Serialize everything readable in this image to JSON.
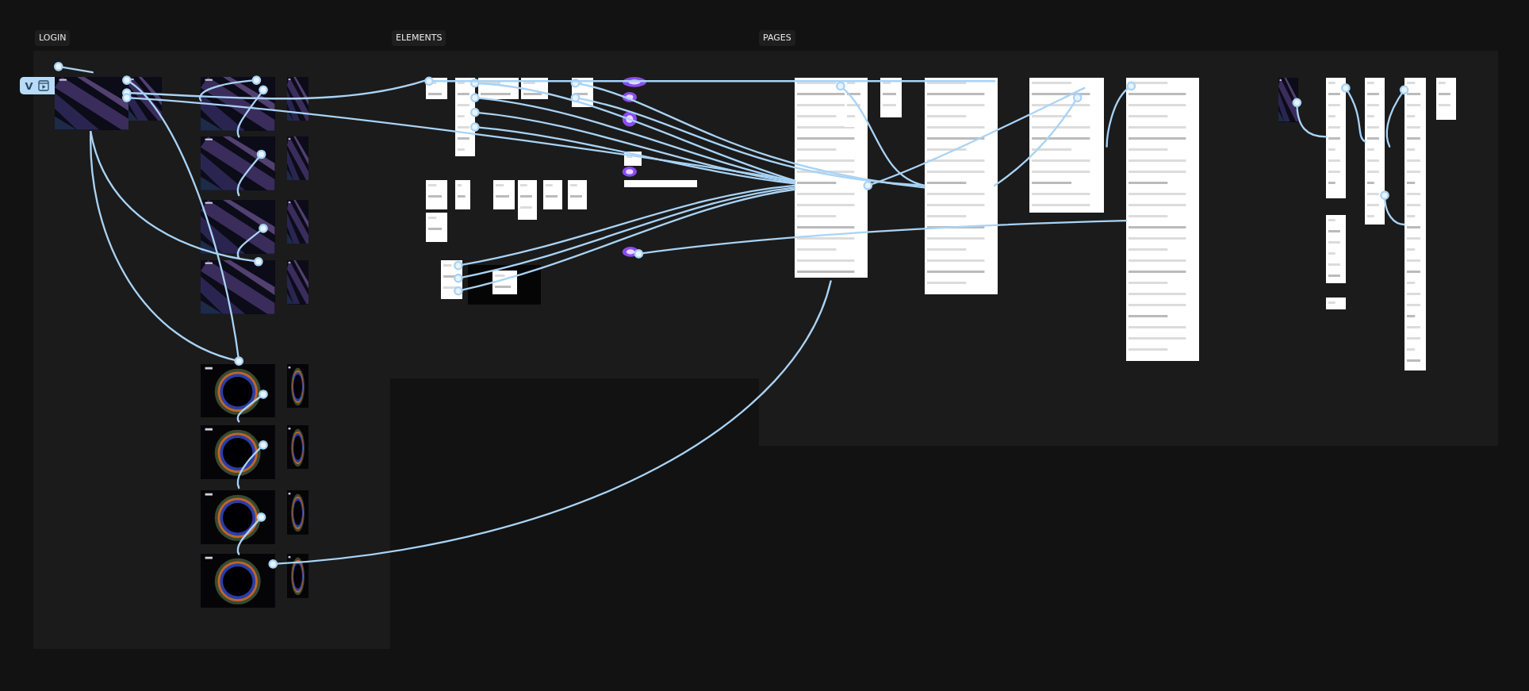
{
  "sections": [
    {
      "label": "LOGIN"
    },
    {
      "label": "ELEMENTS"
    },
    {
      "label": "PAGES"
    }
  ],
  "flow_start": {
    "label": "V"
  }
}
